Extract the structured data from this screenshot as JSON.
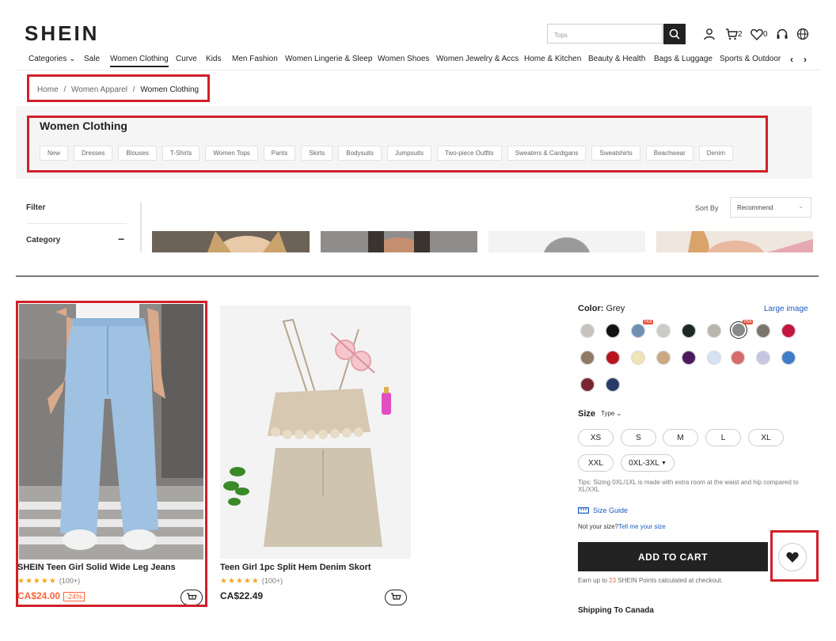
{
  "header": {
    "logo": "SHEIN",
    "search_placeholder": "Tops",
    "cart_count": "2",
    "wishlist_count": "0"
  },
  "nav": {
    "items": [
      "Categories",
      "Sale",
      "Women Clothing",
      "Curve",
      "Kids",
      "Men Fashion",
      "Women Lingerie & Sleep",
      "Women Shoes",
      "Women Jewelry & Accs",
      "Home & Kitchen",
      "Beauty & Health",
      "Bags & Luggage",
      "Sports & Outdoor"
    ],
    "active": "Women Clothing"
  },
  "breadcrumb": {
    "items": [
      "Home",
      "Women Apparel",
      "Women Clothing"
    ],
    "separator": "/"
  },
  "category": {
    "title": "Women Clothing",
    "chips": [
      "New",
      "Dresses",
      "Blouses",
      "T-Shirts",
      "Women Tops",
      "Pants",
      "Skirts",
      "Bodysuits",
      "Jumpsuits",
      "Two-piece Outfits",
      "Sweaters & Cardigans",
      "Sweatshirts",
      "Beachwear",
      "Denim"
    ]
  },
  "filters": {
    "filter_label": "Filter",
    "category_label": "Category",
    "collapse_glyph": "−"
  },
  "sort": {
    "label": "Sort By",
    "selected": "Recommend"
  },
  "products": [
    {
      "title": "SHEIN Teen Girl Solid Wide Leg Jeans",
      "rating_count": "(100+)",
      "price": "CA$24.00",
      "discount": "-24%",
      "price_color": "#fa6338"
    },
    {
      "title": "Teen Girl 1pc Split Hem Denim Skort",
      "rating_count": "(100+)",
      "price": "CA$22.49",
      "discount": "",
      "price_color": "#222222"
    }
  ],
  "product_panel": {
    "color_label": "Color:",
    "color_value": "Grey",
    "large_image_link": "Large image",
    "hot_badge": "Hot",
    "swatches_row1": [
      "#c8c2bc",
      "#111111",
      "#6f8fb3",
      "#c9ccc4",
      "#1d2a22",
      "#b9b6ad",
      "#8a8a8a",
      "#7b766d",
      "#c2153f"
    ],
    "swatches_row2": [
      "#8f7a66",
      "#b8141f",
      "#efe3b8",
      "#c9a982",
      "#4a1a5c",
      "#d4e2f1",
      "#d76a6a",
      "#c7c6e2",
      "#3f7cc8"
    ],
    "swatches_row3": [
      "#7a2532",
      "#2a3a66"
    ],
    "size_label": "Size",
    "type_label": "Type",
    "sizes": [
      "XS",
      "S",
      "M",
      "L",
      "XL",
      "XXL",
      "0XL-3XL"
    ],
    "tips": "Tips: Sizing 0XL/1XL is made with extra room at the waist and hip compared to XL/XXL",
    "size_guide": "Size Guide",
    "not_your_size": "Not your size?",
    "tell_me": "Tell me your size",
    "add_to_cart": "ADD TO CART",
    "points_prefix": "Earn up to",
    "points_value": "23",
    "points_suffix": "SHEIN Points calculated at checkout.",
    "shipping": "Shipping To Canada"
  },
  "colors": {
    "annotation_red": "#d0202a",
    "accent_orange": "#fa6338",
    "link_blue": "#1a5bbf",
    "star": "#f5a623"
  }
}
